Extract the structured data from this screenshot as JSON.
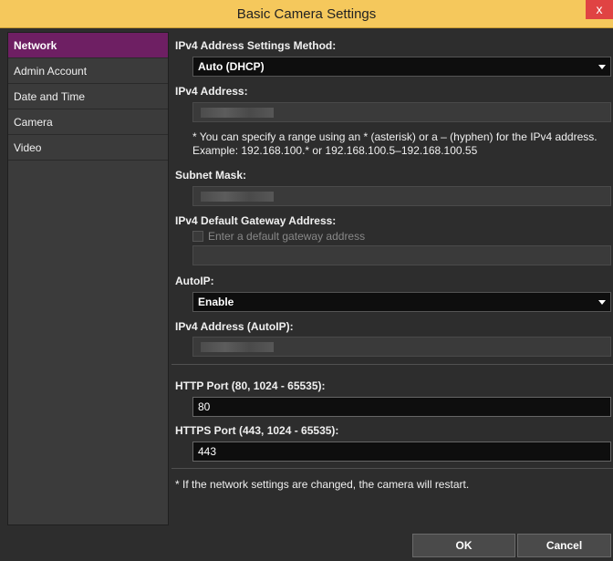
{
  "window": {
    "title": "Basic Camera Settings",
    "close_glyph": "x"
  },
  "sidebar": {
    "items": [
      {
        "label": "Network"
      },
      {
        "label": "Admin Account"
      },
      {
        "label": "Date and Time"
      },
      {
        "label": "Camera"
      },
      {
        "label": "Video"
      }
    ]
  },
  "form": {
    "method_label": "IPv4 Address Settings Method:",
    "method_value": "Auto (DHCP)",
    "ipv4_label": "IPv4 Address:",
    "ipv4_note_line1": "* You can specify a range using an * (asterisk) or a – (hyphen) for the IPv4 address.",
    "ipv4_note_line2": "Example: 192.168.100.* or 192.168.100.5–192.168.100.55",
    "subnet_label": "Subnet Mask:",
    "gateway_label": "IPv4 Default Gateway Address:",
    "gateway_checkbox_label": "Enter a default gateway address",
    "autoip_label": "AutoIP:",
    "autoip_value": "Enable",
    "autoip_address_label": "IPv4 Address (AutoIP):",
    "http_label": "HTTP Port (80, 1024 - 65535):",
    "http_value": "80",
    "https_label": "HTTPS Port (443, 1024 - 65535):",
    "https_value": "443",
    "footnote": "* If the network settings are changed, the camera will restart."
  },
  "buttons": {
    "ok": "OK",
    "cancel": "Cancel"
  },
  "colors": {
    "title_bar": "#f5c85c",
    "active_item": "#6e1f63",
    "close_button": "#e04343"
  }
}
